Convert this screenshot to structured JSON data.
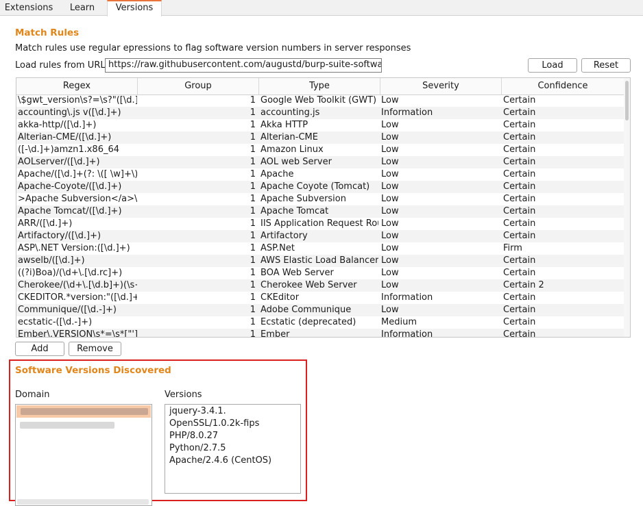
{
  "tabs": [
    {
      "label": "Extensions",
      "active": false
    },
    {
      "label": "Learn",
      "active": false
    },
    {
      "label": "Versions",
      "active": true
    }
  ],
  "match_rules": {
    "title": "Match Rules",
    "description": "Match rules use regular epressions to flag software version numbers in server responses",
    "url_label": "Load rules from URL:",
    "url_value": "https://raw.githubusercontent.com/augustd/burp-suite-software-version-checks",
    "load_label": "Load",
    "reset_label": "Reset",
    "add_label": "Add",
    "remove_label": "Remove",
    "columns": [
      "Regex",
      "Group",
      "Type",
      "Severity",
      "Confidence"
    ],
    "rows": [
      [
        "\\$gwt_version\\s?=\\s?\"([\\d.]+...",
        "1",
        "Google Web Toolkit (GWT)",
        "Low",
        "Certain"
      ],
      [
        "accounting\\.js v([\\d.]+)",
        "1",
        "accounting.js",
        "Information",
        "Certain"
      ],
      [
        "akka-http/([\\d.]+)",
        "1",
        "Akka HTTP",
        "Low",
        "Certain"
      ],
      [
        "Alterian-CME/([\\d.]+)",
        "1",
        "Alterian-CME",
        "Low",
        "Certain"
      ],
      [
        "([-\\d.]+)amzn1.x86_64",
        "1",
        "Amazon Linux",
        "Low",
        "Certain"
      ],
      [
        "AOLserver/([\\d.]+)",
        "1",
        "AOL web Server",
        "Low",
        "Certain"
      ],
      [
        "Apache/([\\d.]+(?: \\([ \\w]+\\))?)",
        "1",
        "Apache",
        "Low",
        "Certain"
      ],
      [
        "Apache-Coyote/([\\d.]+)",
        "1",
        "Apache Coyote (Tomcat)",
        "Low",
        "Certain"
      ],
      [
        ">Apache Subversion</a>\\s+...",
        "1",
        "Apache Subversion",
        "Low",
        "Certain"
      ],
      [
        "Apache Tomcat/([\\d.]+)",
        "1",
        "Apache Tomcat",
        "Low",
        "Certain"
      ],
      [
        "ARR/([\\d.]+)",
        "1",
        "IIS Application Request Rout...",
        "Low",
        "Certain"
      ],
      [
        "Artifactory/([\\d.]+)",
        "1",
        "Artifactory",
        "Low",
        "Certain"
      ],
      [
        "ASP\\.NET Version:([\\d.]+)",
        "1",
        "ASP.Net",
        "Low",
        "Firm"
      ],
      [
        "awselb/([\\d.]+)",
        "1",
        "AWS Elastic Load Balancer",
        "Low",
        "Certain"
      ],
      [
        "((?i)Boa)/(\\d+\\.[\\d.rc]+)",
        "1",
        "BOA Web Server",
        "Low",
        "Certain"
      ],
      [
        "Cherokee/(\\d+\\.[\\d.b]+)(\\s+\\(...",
        "1",
        "Cherokee Web Server",
        "Low",
        "Certain 2"
      ],
      [
        "CKEDITOR.*version:\"([\\d.]+)\"",
        "1",
        "CKEditor",
        "Information",
        "Certain"
      ],
      [
        "Communique/([\\d.-]+)",
        "1",
        "Adobe Communique",
        "Low",
        "Certain"
      ],
      [
        "ecstatic-([\\d.-]+)",
        "1",
        "Ecstatic (deprecated)",
        "Medium",
        "Certain"
      ],
      [
        "Ember\\.VERSION\\s*=\\s*[\"']...",
        "1",
        "Ember",
        "Information",
        "Certain"
      ]
    ]
  },
  "software_versions": {
    "title": "Software Versions Discovered",
    "domain_label": "Domain",
    "versions_label": "Versions",
    "versions": [
      "jquery-3.4.1.",
      "OpenSSL/1.0.2k-fips",
      "PHP/8.0.27",
      "Python/2.7.5",
      "Apache/2.4.6 (CentOS)"
    ]
  },
  "colors": {
    "accent": "#e0861a",
    "highlight_border": "#d9201f",
    "selection": "#f8c9a6"
  }
}
